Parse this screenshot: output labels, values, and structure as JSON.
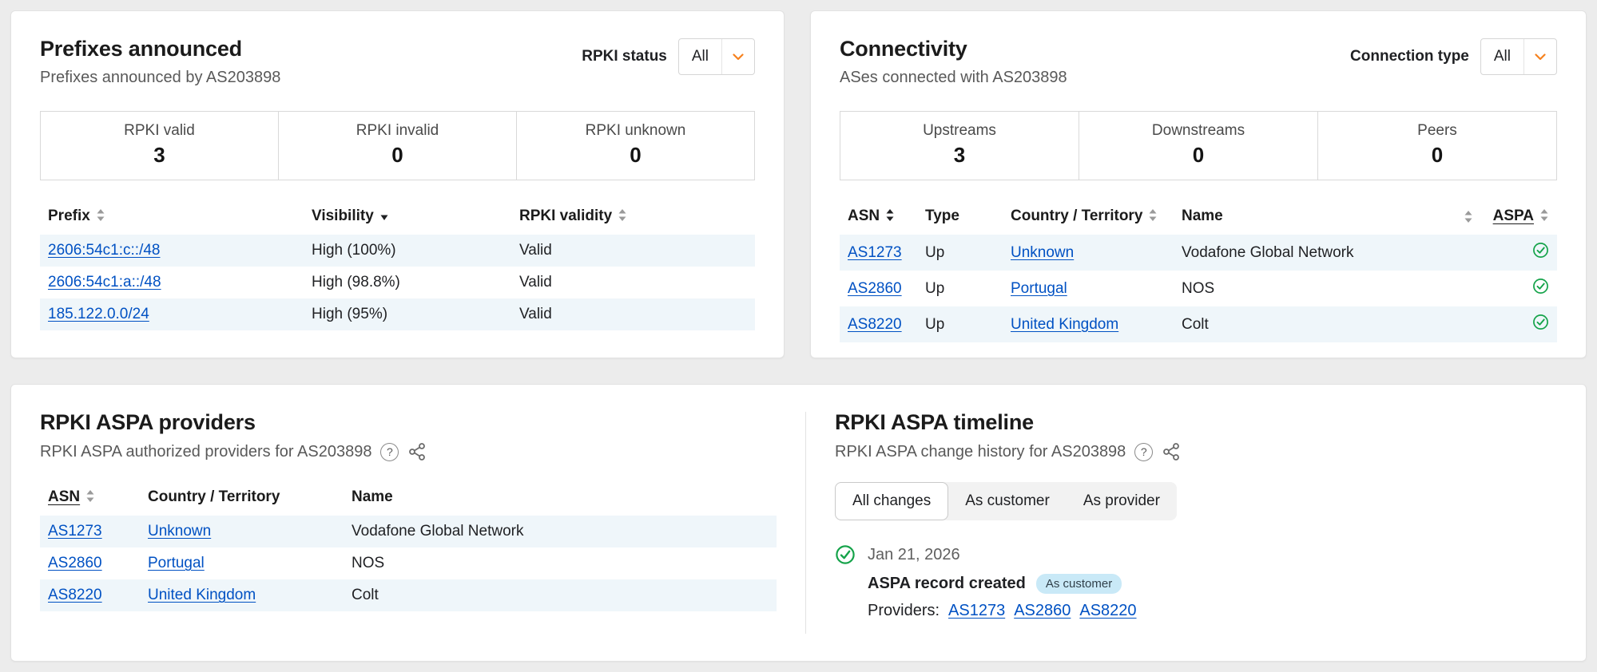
{
  "icons": {
    "help_glyph": "?"
  },
  "colors": {
    "accent_orange": "#f6821f",
    "link_blue": "#0051c3",
    "check_green": "#15a34a",
    "row_alt": "#eff6fa"
  },
  "prefixes": {
    "title": "Prefixes announced",
    "subtitle": "Prefixes announced by AS203898",
    "filter_label": "RPKI status",
    "filter_value": "All",
    "stats": [
      {
        "label": "RPKI valid",
        "value": "3"
      },
      {
        "label": "RPKI invalid",
        "value": "0"
      },
      {
        "label": "RPKI unknown",
        "value": "0"
      }
    ],
    "headers": {
      "prefix": "Prefix",
      "visibility": "Visibility",
      "validity": "RPKI validity"
    },
    "rows": [
      {
        "prefix": "2606:54c1:c::/48",
        "visibility": "High (100%)",
        "validity": "Valid"
      },
      {
        "prefix": "2606:54c1:a::/48",
        "visibility": "High (98.8%)",
        "validity": "Valid"
      },
      {
        "prefix": "185.122.0.0/24",
        "visibility": "High (95%)",
        "validity": "Valid"
      }
    ]
  },
  "connectivity": {
    "title": "Connectivity",
    "subtitle": "ASes connected with AS203898",
    "filter_label": "Connection type",
    "filter_value": "All",
    "stats": [
      {
        "label": "Upstreams",
        "value": "3"
      },
      {
        "label": "Downstreams",
        "value": "0"
      },
      {
        "label": "Peers",
        "value": "0"
      }
    ],
    "headers": {
      "asn": "ASN",
      "type": "Type",
      "country": "Country / Territory",
      "name": "Name",
      "aspa": "ASPA"
    },
    "rows": [
      {
        "asn": "AS1273",
        "type": "Up",
        "country": "Unknown",
        "name": "Vodafone Global Network",
        "aspa_state": "valid"
      },
      {
        "asn": "AS2860",
        "type": "Up",
        "country": "Portugal",
        "name": "NOS",
        "aspa_state": "valid"
      },
      {
        "asn": "AS8220",
        "type": "Up",
        "country": "United Kingdom",
        "name": "Colt",
        "aspa_state": "valid"
      }
    ]
  },
  "aspa_providers": {
    "title": "RPKI ASPA providers",
    "subtitle": "RPKI ASPA authorized providers for AS203898",
    "headers": {
      "asn": "ASN",
      "country": "Country / Territory",
      "name": "Name"
    },
    "rows": [
      {
        "asn": "AS1273",
        "country": "Unknown",
        "name": "Vodafone Global Network"
      },
      {
        "asn": "AS2860",
        "country": "Portugal",
        "name": "NOS"
      },
      {
        "asn": "AS8220",
        "country": "United Kingdom",
        "name": "Colt"
      }
    ]
  },
  "aspa_timeline": {
    "title": "RPKI ASPA timeline",
    "subtitle": "RPKI ASPA change history for AS203898",
    "tabs": [
      {
        "label": "All changes",
        "active": true
      },
      {
        "label": "As customer",
        "active": false
      },
      {
        "label": "As provider",
        "active": false
      }
    ],
    "event": {
      "date": "Jan 21, 2026",
      "title": "ASPA record created",
      "badge": "As customer",
      "providers_label": "Providers:",
      "providers": [
        "AS1273",
        "AS2860",
        "AS8220"
      ]
    }
  }
}
